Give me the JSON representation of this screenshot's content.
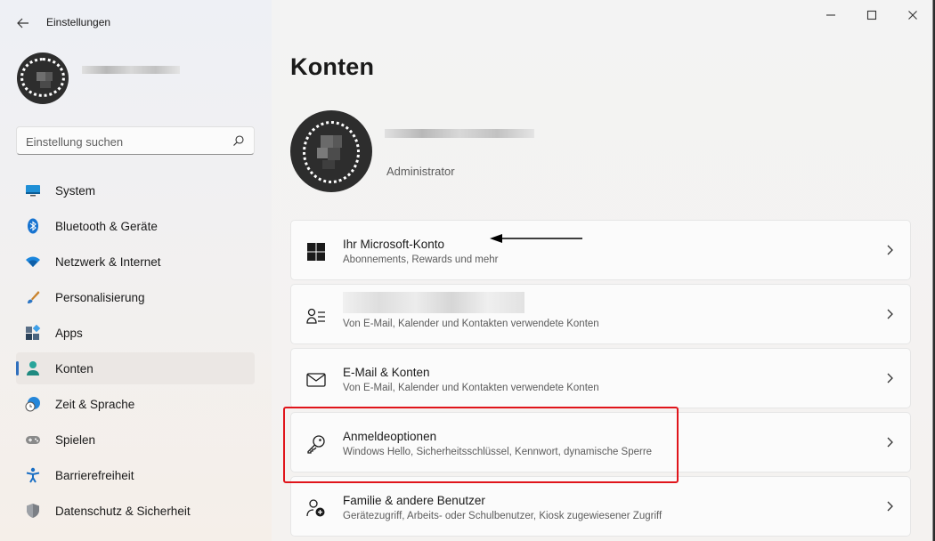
{
  "app": {
    "title": "Einstellungen"
  },
  "window_controls": [
    "minimize",
    "maximize",
    "close"
  ],
  "search": {
    "placeholder": "Einstellung suchen"
  },
  "nav": {
    "items": [
      {
        "label": "System",
        "icon": "monitor-icon"
      },
      {
        "label": "Bluetooth & Geräte",
        "icon": "bluetooth-icon"
      },
      {
        "label": "Netzwerk & Internet",
        "icon": "wifi-icon"
      },
      {
        "label": "Personalisierung",
        "icon": "brush-icon"
      },
      {
        "label": "Apps",
        "icon": "apps-icon"
      },
      {
        "label": "Konten",
        "icon": "person-icon",
        "active": true
      },
      {
        "label": "Zeit & Sprache",
        "icon": "globe-clock-icon"
      },
      {
        "label": "Spielen",
        "icon": "gamepad-icon"
      },
      {
        "label": "Barrierefreiheit",
        "icon": "accessibility-icon"
      },
      {
        "label": "Datenschutz & Sicherheit",
        "icon": "shield-icon"
      }
    ]
  },
  "main": {
    "title": "Konten",
    "user_role": "Administrator",
    "cards": [
      {
        "title": "Ihr Microsoft-Konto",
        "subtitle": "Abonnements, Rewards und mehr",
        "icon": "windows-logo-icon"
      },
      {
        "title": "",
        "subtitle": "Von E-Mail, Kalender und Kontakten verwendete Konten",
        "icon": "person-list-icon"
      },
      {
        "title": "E-Mail & Konten",
        "subtitle": "Von E-Mail, Kalender und Kontakten verwendete Konten",
        "icon": "mail-icon"
      },
      {
        "title": "Anmeldeoptionen",
        "subtitle": "Windows Hello, Sicherheitsschlüssel, Kennwort, dynamische Sperre",
        "icon": "key-icon"
      },
      {
        "title": "Familie & andere Benutzer",
        "subtitle": "Gerätezugriff, Arbeits- oder Schulbenutzer, Kiosk zugewiesener Zugriff",
        "icon": "person-add-icon"
      }
    ]
  },
  "colors": {
    "accent": "#2f6fbd",
    "highlight": "#e0151b",
    "active_nav_bg": "#ebe7e4"
  }
}
